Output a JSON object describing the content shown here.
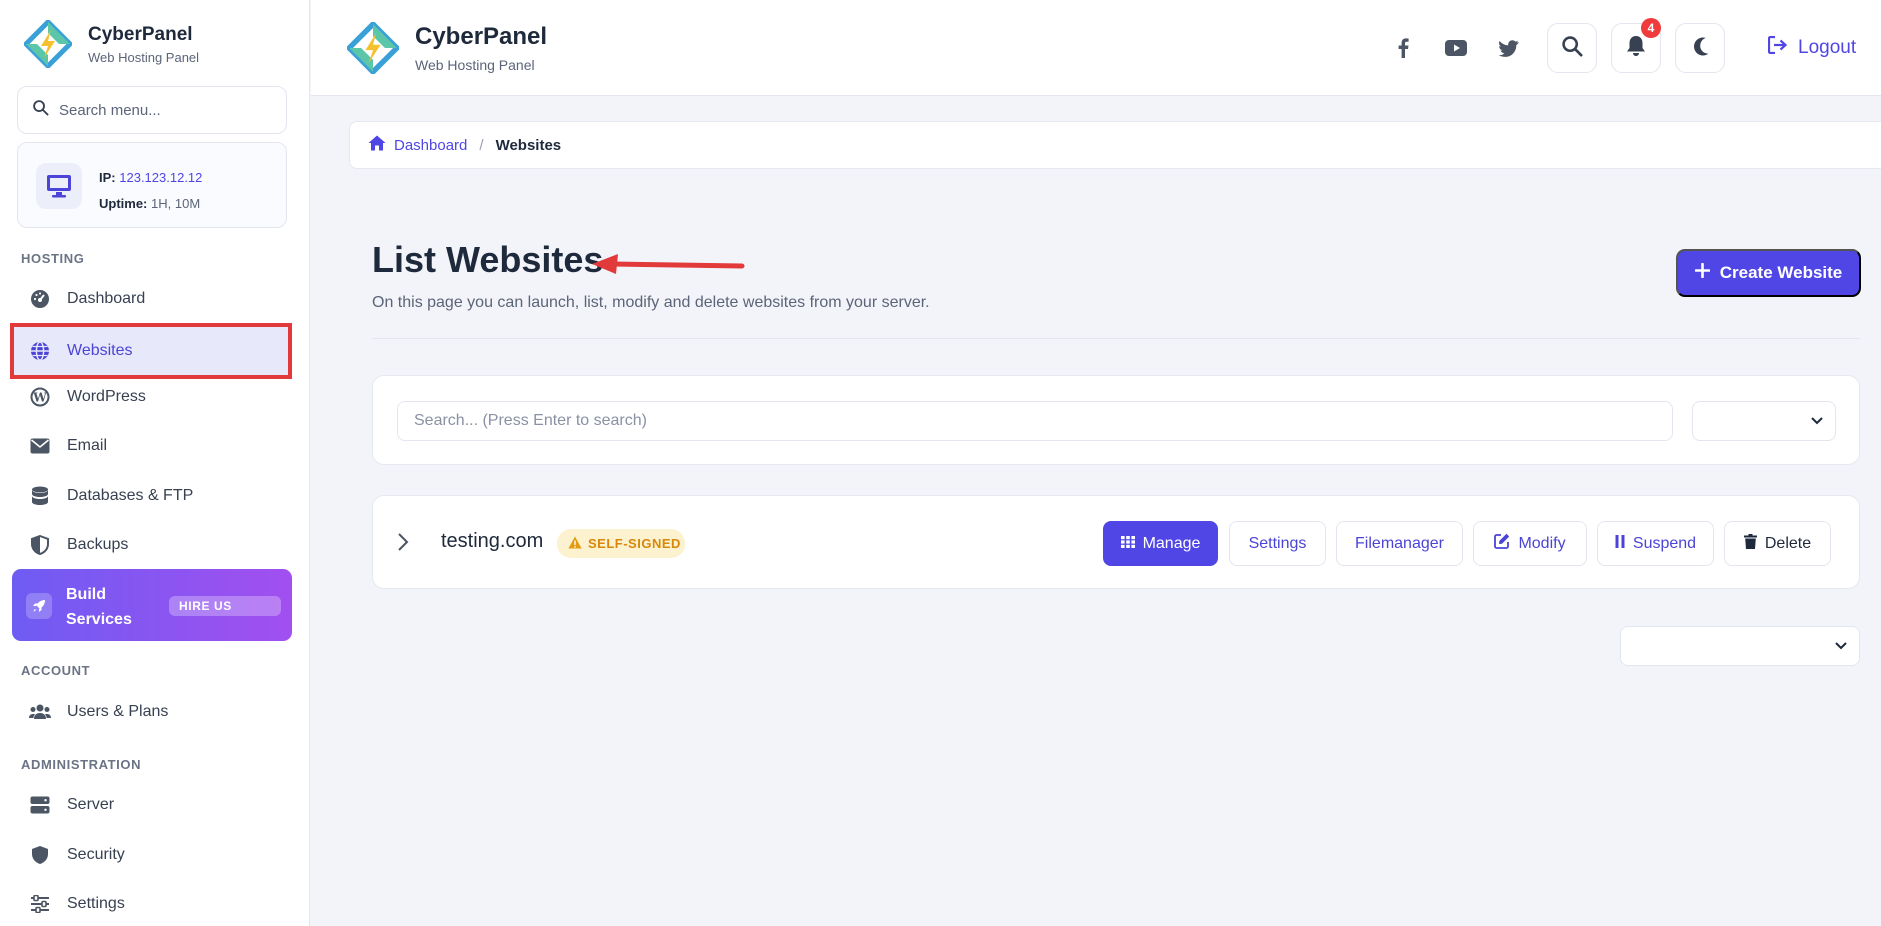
{
  "brand": {
    "title": "CyberPanel",
    "subtitle": "Web Hosting Panel"
  },
  "sidebar": {
    "search_placeholder": "Search menu...",
    "server": {
      "ip_label": "IP:",
      "ip": "123.123.12.12",
      "uptime_label": "Uptime:",
      "uptime": "1H, 10M"
    },
    "sections": {
      "hosting": "HOSTING",
      "account": "ACCOUNT",
      "administration": "ADMINISTRATION"
    },
    "items": {
      "dashboard": "Dashboard",
      "websites": "Websites",
      "wordpress": "WordPress",
      "email": "Email",
      "databases": "Databases & FTP",
      "backups": "Backups",
      "users": "Users & Plans",
      "server": "Server",
      "security": "Security",
      "settings": "Settings"
    },
    "build": {
      "line1": "Build",
      "line2": "Services",
      "badge": "HIRE US"
    },
    "active_item": "websites"
  },
  "header": {
    "notification_count": "4",
    "logout_label": "Logout",
    "icons": [
      "facebook-icon",
      "youtube-icon",
      "twitter-icon",
      "search-icon",
      "bell-icon",
      "moon-icon"
    ]
  },
  "breadcrumb": {
    "home": "Dashboard",
    "separator": "/",
    "current": "Websites"
  },
  "page": {
    "title": "List Websites",
    "subtitle": "On this page you can launch, list, modify and delete websites from your server.",
    "create_button": "Create Website"
  },
  "search": {
    "placeholder": "Search... (Press Enter to search)",
    "filter_value": "",
    "pagination_value": ""
  },
  "sites": [
    {
      "domain": "testing.com",
      "ssl_badge": "SELF-SIGNED",
      "actions": {
        "manage": "Manage",
        "settings": "Settings",
        "filemanager": "Filemanager",
        "modify": "Modify",
        "suspend": "Suspend",
        "delete": "Delete"
      }
    }
  ],
  "colors": {
    "accent": "#5046e5",
    "danger": "#ef3b3b",
    "warning": "#d8880b",
    "highlight_frame": "#e23a3a"
  }
}
